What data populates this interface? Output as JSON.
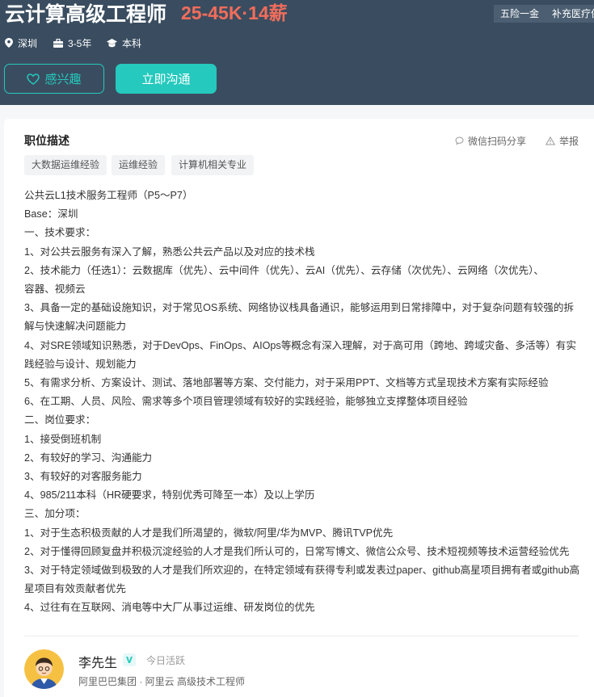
{
  "header": {
    "job_title": "云计算高级工程师",
    "salary": "25-45K·14薪",
    "benefits": [
      "五险一金",
      "补充医疗保"
    ],
    "location": "深圳",
    "experience": "3-5年",
    "degree": "本科",
    "interest_button": "感兴趣",
    "chat_button": "立即沟通"
  },
  "card": {
    "section_title": "职位描述",
    "share_label": "微信扫码分享",
    "report_label": "举报",
    "skill_tags": [
      "大数据运维经验",
      "运维经验",
      "计算机相关专业"
    ],
    "description_lines": [
      "公共云L1技术服务工程师（P5～P7）",
      "Base：深圳",
      "一、技术要求：",
      "1、对公共云服务有深入了解，熟悉公共云产品以及对应的技术栈",
      "2、技术能力（任选1）：云数据库（优先）、云中间件（优先）、云AI（优先）、云存储（次优先）、云网络（次优先）、",
      "容器、视频云",
      "3、具备一定的基础设施知识，对于常见OS系统、网络协议栈具备通识，能够运用到日常排障中，对于复杂问题有较强的拆",
      "解与快速解决问题能力",
      "4、对SRE领域知识熟悉，对于DevOps、FinOps、AIOps等概念有深入理解，对于高可用（跨地、跨域灾备、多活等）有实",
      "践经验与设计、规划能力",
      "5、有需求分析、方案设计、测试、落地部署等方案、交付能力，对于采用PPT、文档等方式呈现技术方案有实际经验",
      "6、在工期、人员、风险、需求等多个项目管理领域有较好的实践经验，能够独立支撑整体项目经验",
      "二、岗位要求：",
      "1、接受倒班机制",
      "2、有较好的学习、沟通能力",
      "3、有较好的对客服务能力",
      "4、985/211本科（HR硬要求，特别优秀可降至一本）及以上学历",
      "三、加分项：",
      "1、对于生态积极贡献的人才是我们所渴望的，微软/阿里/华为MVP、腾讯TVP优先",
      "2、对于懂得回顾复盘并积极沉淀经验的人才是我们所认可的，日常写博文、微信公众号、技术短视频等技术运营经验优先",
      "3、对于特定领域做到极致的人才是我们所欢迎的，在特定领域有获得专利或发表过paper、github高星项目拥有者或github高",
      "星项目有效贡献者优先",
      "4、过往有在互联网、消电等中大厂从事过运维、研发岗位的优先"
    ],
    "recruiter": {
      "name": "李先生",
      "active_status": "今日活跃",
      "company_line": "阿里巴巴集团 · 阿里云 高级技术工程师"
    }
  },
  "colors": {
    "header_bg": "#3a4d60",
    "accent": "#25c9bd",
    "salary": "#f26d5b"
  }
}
